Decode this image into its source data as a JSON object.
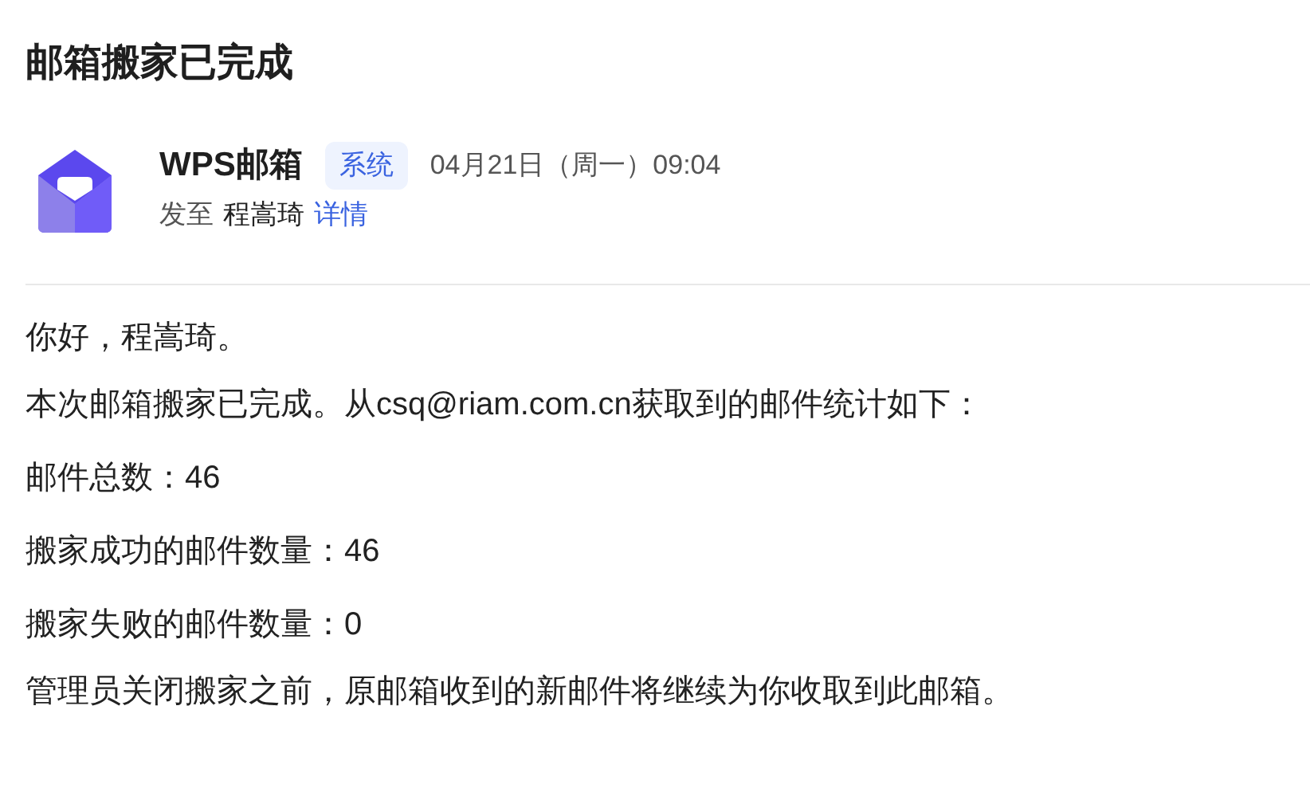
{
  "subject": "邮箱搬家已完成",
  "sender": {
    "name": "WPS邮箱",
    "tag": "系统",
    "date": "04月21日（周一）09:04"
  },
  "recipient": {
    "prefix": "发至",
    "name": "程嵩琦",
    "details_link": "详情"
  },
  "body": [
    [
      "你好，程嵩琦。"
    ],
    [
      "本次邮箱搬家已完成。从csq@riam.com.cn获取到的邮件统计如下：",
      "邮件总数：46",
      "搬家成功的邮件数量：46",
      "搬家失败的邮件数量：0"
    ],
    [
      "管理员关闭搬家之前，原邮箱收到的新邮件将继续为你收取到此邮箱。"
    ]
  ]
}
